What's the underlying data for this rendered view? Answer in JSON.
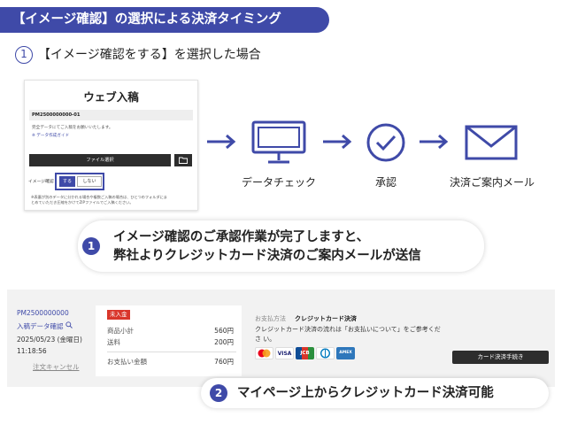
{
  "banner": {
    "title": "【イメージ確認】の選択による決済タイミング"
  },
  "step": {
    "number": "1",
    "title": "【イメージ確認をする】を選択した場合"
  },
  "upload_panel": {
    "title": "ウェブ入稿",
    "order_number": "PM2500000000-01",
    "note": "完全データにてご入稿をお願いいたします。",
    "guide_link": "※ データ作成ガイド",
    "file_button": "ファイル選択",
    "file_icon": "folder-icon",
    "confirm_label": "イメージ確認",
    "toggle_yes": "する",
    "toggle_no": "しない",
    "footer_line1": "※表裏が別のデータに分かれる場合や複数ご入稿の場合は、ひとつのフォルダにま",
    "footer_line2": "とめていただき圧縮をかけてZIPファイルでご入稿ください。"
  },
  "flow": {
    "steps": [
      {
        "label": "データチェック",
        "icon": "monitor-icon"
      },
      {
        "label": "承認",
        "icon": "check-circle-icon"
      },
      {
        "label": "決済ご案内メール",
        "icon": "mail-icon"
      }
    ]
  },
  "callout1": {
    "badge": "1",
    "line1": "イメージ確認のご承認作業が完了しますと、",
    "line2": "弊社よりクレジットカード決済のご案内メールが送信"
  },
  "mypage": {
    "order_number": "PM2500000000",
    "page_link": "入稿データ確認",
    "date": "2025/05/23 (金曜日)",
    "time": "11:18:56",
    "cancel_link": "注文キャンセル",
    "status_badge": "未入金",
    "rows": [
      {
        "label": "商品小計",
        "value": "560円"
      },
      {
        "label": "送料",
        "value": "200円"
      },
      {
        "label": "お支払い金額",
        "value": "760円"
      }
    ],
    "payment_label": "お支払方法",
    "payment_method": "クレジットカード決済",
    "payment_desc": "クレジットカード決済の流れは「お支払いについて」をご参考くださ い。",
    "card_button": "カード決済手続き",
    "card_logos": [
      "MC",
      "VISA",
      "JCB",
      "Diners",
      "AMEX"
    ]
  },
  "callout2": {
    "badge": "2",
    "text": "マイページ上からクレジットカード決済可能"
  },
  "colors": {
    "accent": "#3f4aa8",
    "dark": "#2d2d2d",
    "status": "#d9362b"
  }
}
